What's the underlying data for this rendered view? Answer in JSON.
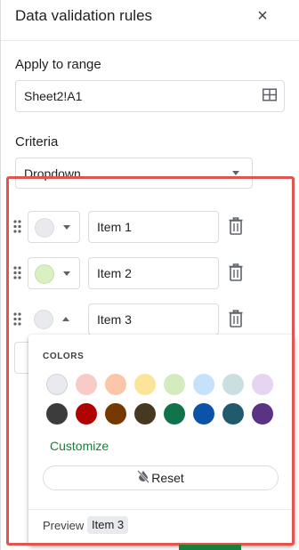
{
  "header": {
    "title": "Data validation rules",
    "close_glyph": "×"
  },
  "range": {
    "label": "Apply to range",
    "value": "Sheet2!A1",
    "icon": "grid-select-icon"
  },
  "criteria": {
    "label": "Criteria",
    "value": "Dropdown"
  },
  "items": [
    {
      "value": "Item 1",
      "color": "#e8eaed"
    },
    {
      "value": "Item 2",
      "color": "#d9f0c3"
    },
    {
      "value": "Item 3",
      "color": "#e8eaed"
    }
  ],
  "color_popup": {
    "section_label": "COLORS",
    "swatches_row1": [
      "#e8eaed",
      "#f9cbc7",
      "#fbc7a8",
      "#fde49b",
      "#d4ebbe",
      "#c6e1fa",
      "#c9dfe0",
      "#e7d4f3"
    ],
    "swatches_row2": [
      "#3c3c3c",
      "#b10202",
      "#753800",
      "#473822",
      "#11734b",
      "#0a53a8",
      "#215a6c",
      "#5a3286"
    ],
    "customize_label": "Customize",
    "reset_label": "Reset",
    "preview_label": "Preview",
    "preview_chip": "Item 3"
  },
  "colors": {
    "accent_green": "#188038",
    "highlight_frame": "#e0564f",
    "border": "#dadce0"
  }
}
